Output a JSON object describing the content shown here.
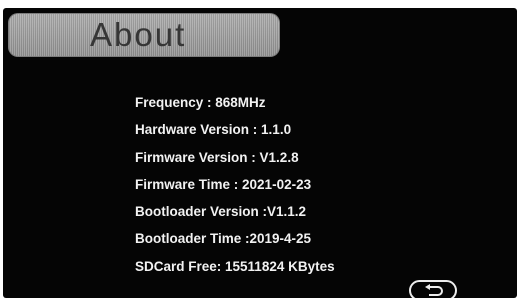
{
  "header": {
    "title": "About"
  },
  "info": {
    "lines": [
      "Frequency : 868MHz",
      "Hardware Version : 1.1.0",
      "Firmware Version : V1.2.8",
      "Firmware Time : 2021-02-23",
      "Bootloader Version :V1.1.2",
      "Bootloader Time :2019-4-25",
      "SDCard Free: 15511824 KBytes"
    ]
  },
  "controls": {
    "back_icon": "return-arrow-icon"
  },
  "colors": {
    "panel_background": "#050505",
    "title_tab": "#9e9e9e",
    "title_text": "#363636",
    "info_text": "#f2f2f2",
    "button_outline": "#ededed"
  }
}
